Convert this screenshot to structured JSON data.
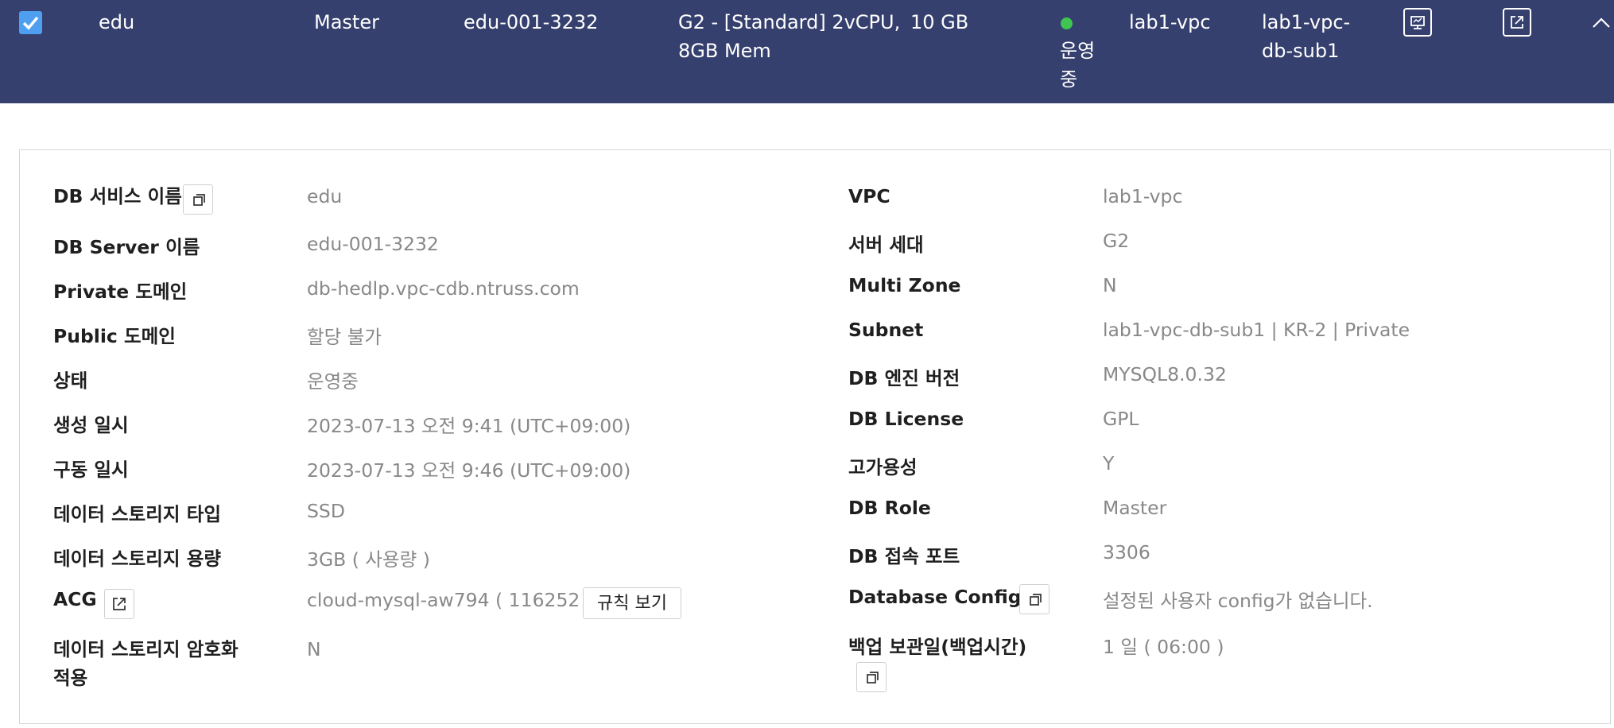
{
  "row": {
    "name": "edu",
    "role": "Master",
    "server": "edu-001-3232",
    "spec_line1": "G2 - [Standard] 2vCPU,",
    "spec_line2": "8GB Mem",
    "storage": "10 GB",
    "status_line1": "운영",
    "status_line2": "중",
    "status_color": "#3fc552",
    "vpc": "lab1-vpc",
    "subnet_line1": "lab1-vpc-",
    "subnet_line2": "db-sub1",
    "icons": [
      "monitor-icon",
      "external-link-icon",
      "chevron-up-icon"
    ]
  },
  "detail_left": [
    {
      "label": "DB 서비스 이름",
      "value": "edu"
    },
    {
      "label": "DB Server 이름",
      "value": "edu-001-3232"
    },
    {
      "label": "Private 도메인",
      "value": "db-hedlp.vpc-cdb.ntruss.com"
    },
    {
      "label": "Public 도메인",
      "value": "할당 불가"
    },
    {
      "label": "상태",
      "value": "운영중"
    },
    {
      "label": "생성 일시",
      "value": "2023-07-13 오전 9:41 (UTC+09:00)"
    },
    {
      "label": "구동 일시",
      "value": "2023-07-13 오전 9:46 (UTC+09:00)"
    },
    {
      "label": "데이터 스토리지 타입",
      "value": "SSD"
    },
    {
      "label": "데이터 스토리지 용량",
      "value": "3GB ( 사용량 )"
    },
    {
      "label": "ACG",
      "value": "cloud-mysql-aw794 ( 116252 )",
      "button": "규칙 보기"
    },
    {
      "label_line1": "데이터 스토리지 암호화",
      "label_line2": "적용",
      "value": "N"
    }
  ],
  "detail_right": [
    {
      "label": "VPC",
      "value": "lab1-vpc"
    },
    {
      "label": "서버 세대",
      "value": "G2"
    },
    {
      "label": "Multi Zone",
      "value": "N"
    },
    {
      "label": "Subnet",
      "value": "lab1-vpc-db-sub1 | KR-2 | Private"
    },
    {
      "label": "DB 엔진 버전",
      "value": "MYSQL8.0.32"
    },
    {
      "label": "DB License",
      "value": "GPL"
    },
    {
      "label": "고가용성",
      "value": "Y"
    },
    {
      "label": "DB Role",
      "value": "Master"
    },
    {
      "label": "DB 접속 포트",
      "value": "3306"
    },
    {
      "label": "Database Config",
      "value": "설정된 사용자 config가 없습니다."
    },
    {
      "label": "백업 보관일(백업시간)",
      "value": "1 일 ( 06:00 )"
    }
  ],
  "colors": {
    "header_bg": "#36406e",
    "checkbox": "#4f9ff0",
    "value_text": "#888888"
  }
}
